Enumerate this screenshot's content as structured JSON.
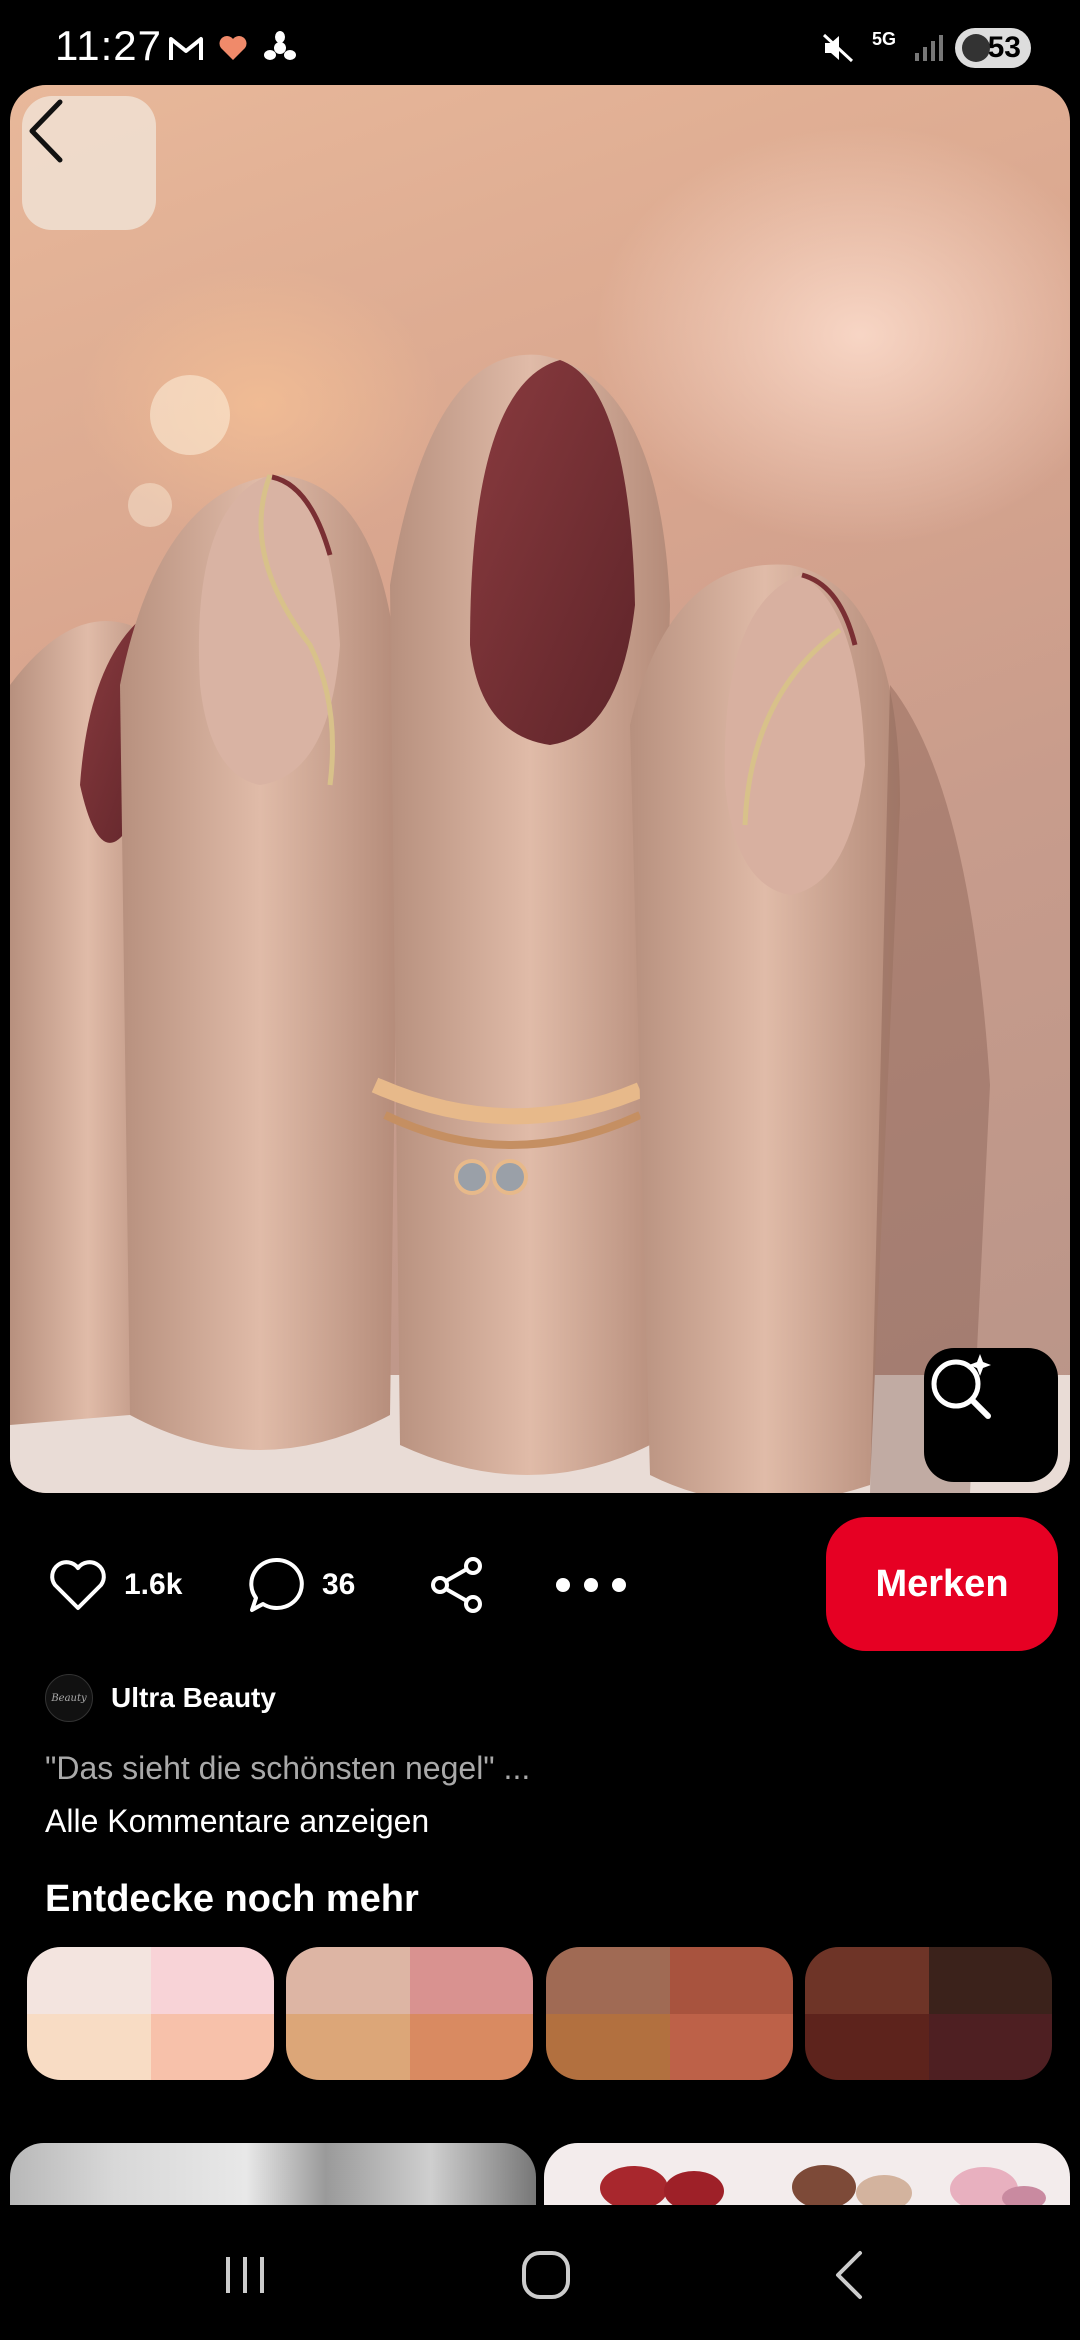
{
  "status_bar": {
    "time": "11:27",
    "network": "5G",
    "battery": "53",
    "icons": [
      "gmail-icon",
      "heart-icon",
      "fan-icon",
      "mute-icon",
      "signal-icon",
      "battery-icon"
    ]
  },
  "pin": {
    "image_description_icon": "nail-photo",
    "back_icon": "chevron-left-icon",
    "visual_search_icon": "lens-sparkle-icon"
  },
  "actions": {
    "likes": "1.6k",
    "comments": "36",
    "save_label": "Merken",
    "icons": [
      "heart-icon",
      "comment-icon",
      "share-icon",
      "more-icon"
    ]
  },
  "author": {
    "name": "Ultra Beauty",
    "avatar_text": "Beauty"
  },
  "comments": {
    "preview": "\"Das sieht die schönsten negel\" ...",
    "show_all": "Alle Kommentare anzeigen"
  },
  "explore": {
    "title": "Entdecke noch mehr",
    "palettes": [
      [
        "#f3e4df",
        "#f8d3d7",
        "#f8dcc4",
        "#f7c1aa"
      ],
      [
        "#ddb5a4",
        "#d99290",
        "#dca678",
        "#d98a61"
      ],
      [
        "#a06a54",
        "#a8533e",
        "#b2703f",
        "#bd6148"
      ],
      [
        "#6e3427",
        "#3b221b",
        "#5d231c",
        "#4e1f22"
      ]
    ]
  },
  "colors": {
    "accent": "#e60023",
    "background": "#000000",
    "muted_text": "#a9a9a9"
  }
}
